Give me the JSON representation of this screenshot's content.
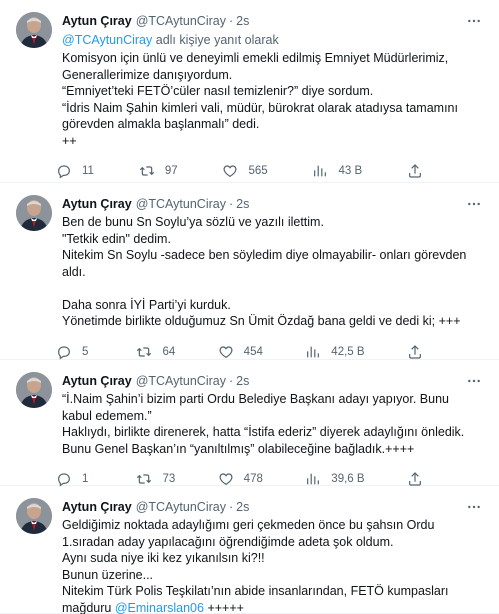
{
  "tweets": [
    {
      "author_name": "Aytun Çıray",
      "handle": "@TCAytunCiray",
      "time": "2s",
      "reply_prefix": "@TCAytunCiray",
      "reply_suffix": "adlı kişiye yanıt olarak",
      "lines": [
        "Komisyon için ünlü ve deneyimli emekli edilmiş Emniyet Müdürlerimiz,",
        "Generallerimize danışıyordum.",
        "“Emniyet’teki FETÖ’cüler nasıl temizlenir?” diye sordum.",
        "“İdris Naim Şahin kimleri vali, müdür, bürokrat olarak atadıysa tamamını",
        "görevden almakla başlanmalı” dedi.",
        "++"
      ],
      "replies": "11",
      "retweets": "97",
      "likes": "565",
      "views": "43 B"
    },
    {
      "author_name": "Aytun Çıray",
      "handle": "@TCAytunCiray",
      "time": "2s",
      "lines": [
        "Ben de bunu Sn Soylu’ya sözlü ve yazılı ilettim.",
        "\"Tetkik edin\" dedim.",
        "Nitekim Sn Soylu -sadece ben söyledim diye olmayabilir- onları görevden",
        "aldı.",
        "",
        "Daha sonra İYİ Parti’yi kurduk.",
        "Yönetimde birlikte olduğumuz Sn Ümit Özdağ bana geldi ve dedi ki; +++"
      ],
      "replies": "5",
      "retweets": "64",
      "likes": "454",
      "views": "42,5 B"
    },
    {
      "author_name": "Aytun Çıray",
      "handle": "@TCAytunCiray",
      "time": "2s",
      "lines": [
        "“İ.Naim Şahin’i bizim parti Ordu Belediye Başkanı adayı yapıyor. Bunu",
        "kabul edemem.”",
        "Haklıydı, birlikte direnerek, hatta “İstifa ederiz” diyerek adaylığını önledik.",
        "Bunu Genel Başkan’ın “yanıltılmış” olabileceğine bağladık.++++"
      ],
      "replies": "1",
      "retweets": "73",
      "likes": "478",
      "views": "39,6 B"
    },
    {
      "author_name": "Aytun Çıray",
      "handle": "@TCAytunCiray",
      "time": "2s",
      "lines": [
        "Geldiğimiz noktada adaylığımı geri çekmeden önce bu şahsın Ordu",
        "1.sıradan aday yapılacağını öğrendiğimde adeta şok oldum.",
        "Aynı suda niye iki kez yıkanılsın ki?!!",
        "Bunun üzerine...",
        "Nitekim Türk Polis Teşkilatı’nın abide insanlarından, FETÖ kumpasları"
      ],
      "last_line_prefix": "mağduru",
      "last_line_mention": "@Eminarslan06",
      "last_line_suffix": "+++++"
    }
  ],
  "icons": {
    "reply": "reply-icon",
    "retweet": "retweet-icon",
    "like": "heart-icon",
    "views": "views-icon",
    "share": "share-icon",
    "more": "more-icon"
  },
  "colors": {
    "text": "#0f1419",
    "secondary": "#536471",
    "link": "#1d9bf0",
    "divider": "#eff3f4"
  }
}
